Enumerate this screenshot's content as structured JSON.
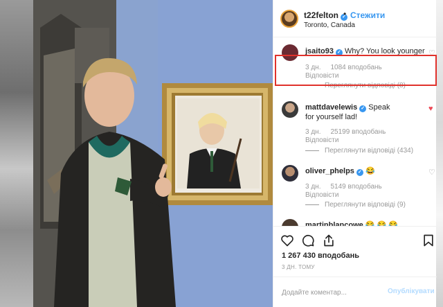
{
  "post": {
    "username": "t22felton",
    "follow_label": "Стежити",
    "dot": "•",
    "location": "Toronto, Canada"
  },
  "comments": [
    {
      "username": "jsaito93",
      "verified": true,
      "text": "Why? You look younger",
      "time": "3 дн.",
      "likes": "1084 вподобань",
      "reply": "Відповісти",
      "view_replies": "Переглянути відповіді (8)",
      "liked": false,
      "avatar_color": "#6b2a32"
    },
    {
      "username": "mattdavelewis",
      "verified": true,
      "text": "Speak for yourself lad!",
      "time": "3 дн.",
      "likes": "25199 вподобань",
      "reply": "Відповісти",
      "view_replies": "Переглянути відповіді (434)",
      "liked": true,
      "avatar_color": "#3a3a3a"
    },
    {
      "username": "oliver_phelps",
      "verified": true,
      "text": "😂",
      "time": "3 дн.",
      "likes": "5149 вподобань",
      "reply": "Відповісти",
      "view_replies": "Переглянути відповіді (9)",
      "liked": false,
      "avatar_color": "#2e2e3a"
    },
    {
      "username": "martinblancowe",
      "verified": false,
      "text": "😂 😂 😂",
      "liked": false,
      "avatar_color": "#4b3b2f"
    }
  ],
  "actions": {
    "likes": "1 267 430 вподобань",
    "time": "3 ДН. ТОМУ",
    "comment_placeholder": "Додайте коментар...",
    "publish_label": "Опублікувати"
  },
  "colors": {
    "accent": "#3897f0",
    "liked": "#ed4956",
    "highlight": "#e0312b"
  },
  "icons": [
    "heart-icon",
    "comment-icon",
    "share-icon",
    "bookmark-icon",
    "verified-badge-icon"
  ]
}
